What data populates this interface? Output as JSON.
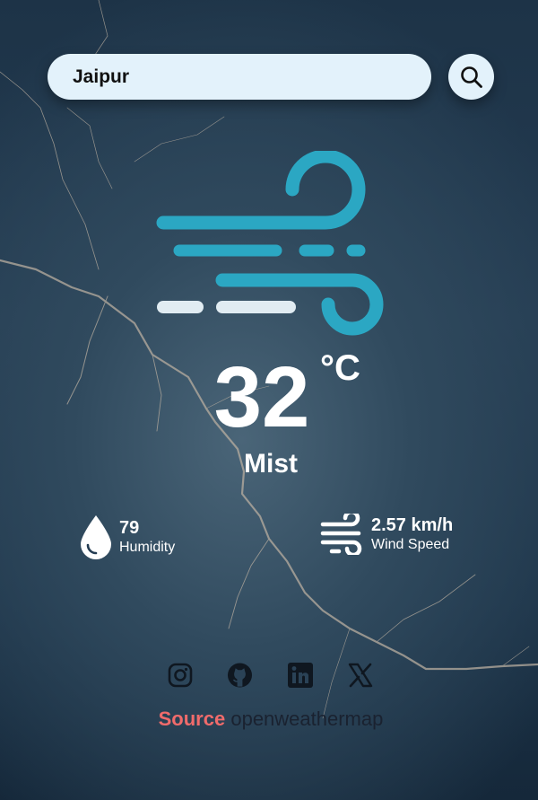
{
  "search": {
    "value": "Jaipur",
    "button_icon": "search-icon"
  },
  "weather": {
    "icon": "wind-icon",
    "temperature": "32",
    "unit": "°C",
    "condition": "Mist"
  },
  "details": {
    "humidity": {
      "icon": "water-drop-icon",
      "value": "79",
      "label": "Humidity"
    },
    "wind": {
      "icon": "wind-icon",
      "value": "2.57 km/h",
      "label": "Wind Speed"
    }
  },
  "socials": [
    "instagram-icon",
    "github-icon",
    "linkedin-icon",
    "x-icon"
  ],
  "footer": {
    "source_label": "Source",
    "source_link": "openweathermap"
  },
  "colors": {
    "accent": "#2ba7c3",
    "source_label": "#f06b6b",
    "input_bg": "#e3f2fb"
  }
}
